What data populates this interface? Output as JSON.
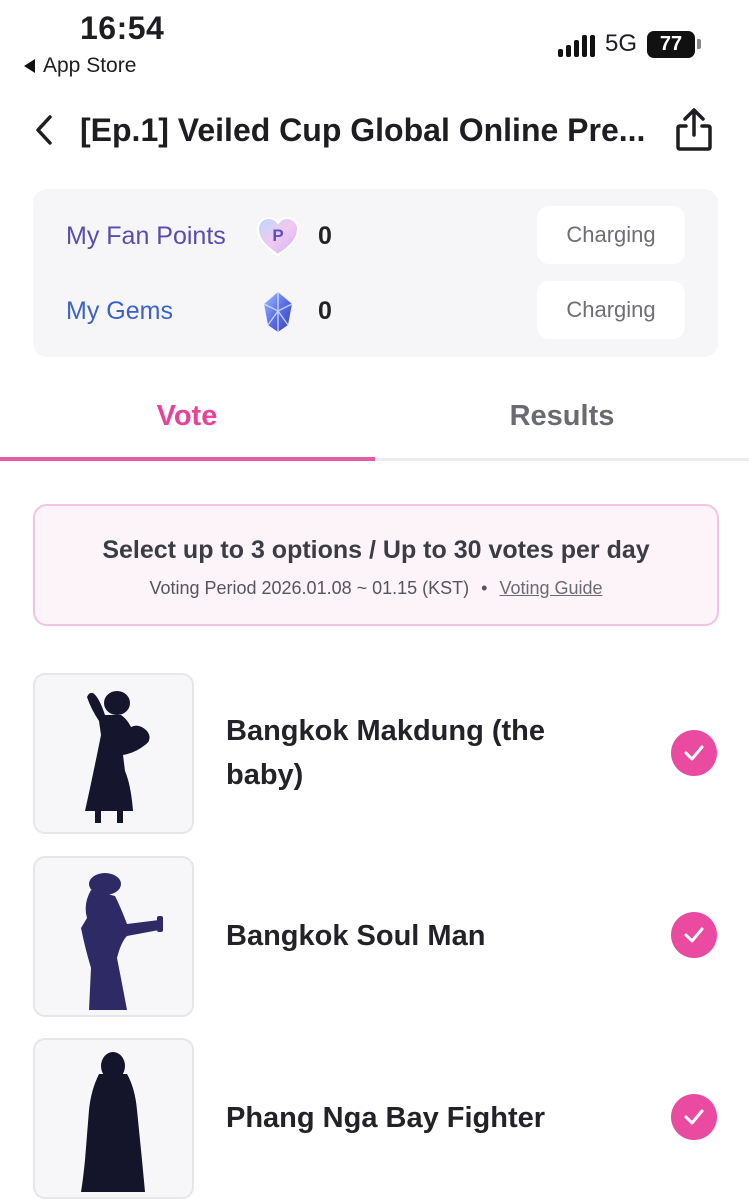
{
  "status_bar": {
    "time": "16:54",
    "back_app": "App Store",
    "network": "5G",
    "battery": "77"
  },
  "header": {
    "title": "[Ep.1] Veiled Cup Global Online Pre..."
  },
  "points": {
    "fan_points": {
      "label": "My Fan Points",
      "value": "0",
      "button": "Charging",
      "icon_letter": "P"
    },
    "gems": {
      "label": "My Gems",
      "value": "0",
      "button": "Charging"
    }
  },
  "tabs": [
    {
      "label": "Vote",
      "active": true
    },
    {
      "label": "Results",
      "active": false
    }
  ],
  "notice": {
    "main": "Select up to 3 options / Up to 30 votes per day",
    "period": "Voting Period 2026.01.08 ~ 01.15 (KST)",
    "separator": "•",
    "guide_link": "Voting Guide"
  },
  "candidates": [
    {
      "name": "Bangkok Makdung (the baby)",
      "checked": true
    },
    {
      "name": "Bangkok Soul Man",
      "checked": true
    },
    {
      "name": "Phang Nga Bay Fighter",
      "checked": true
    }
  ],
  "colors": {
    "accent": "#e8439a",
    "check_bg": "#ea4aa0",
    "fan_label": "#5b4bb0",
    "gem_label": "#3a62c8"
  }
}
